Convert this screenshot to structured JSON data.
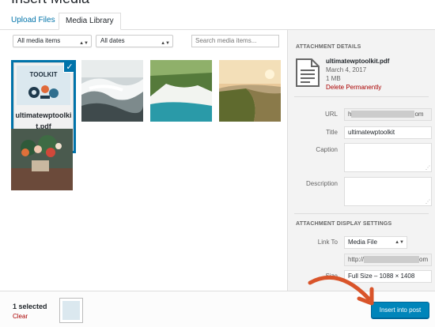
{
  "modal": {
    "title": "Insert Media"
  },
  "tabs": [
    {
      "label": "Upload Files"
    },
    {
      "label": "Media Library"
    }
  ],
  "filters": {
    "type_selected": "All media items",
    "date_selected": "All dates",
    "search_placeholder": "Search media items..."
  },
  "grid": {
    "items": [
      {
        "type": "document",
        "filename": "ultimatewptoolkit.pdf",
        "cover_text": "TOOLKIT",
        "selected": true
      },
      {
        "type": "image",
        "subject": "waves crashing on rocky coast"
      },
      {
        "type": "image",
        "subject": "waterfall in green landscape"
      },
      {
        "type": "image",
        "subject": "coastal cliffs at sunset"
      },
      {
        "type": "image",
        "subject": "flowers on table"
      }
    ]
  },
  "details": {
    "section_title": "Attachment Details",
    "filename": "ultimatewptoolkit.pdf",
    "date": "March 4, 2017",
    "size": "1 MB",
    "delete_label": "Delete Permanently",
    "fields": {
      "url_label": "URL",
      "url_value_start": "h",
      "url_value_end": "om",
      "title_label": "Title",
      "title_value": "ultimatewptoolkit",
      "caption_label": "Caption",
      "description_label": "Description"
    }
  },
  "display_settings": {
    "section_title": "Attachment Display Settings",
    "link_to_label": "Link To",
    "link_to_value": "Media File",
    "link_url_start": "http://",
    "link_url_end": "om",
    "size_label": "Size",
    "size_value": "Full Size – 1088 × 1408"
  },
  "toolbar": {
    "selected_count": "1 selected",
    "clear_label": "Clear",
    "insert_label": "Insert into post"
  },
  "colors": {
    "accent": "#0073aa",
    "button": "#0085ba",
    "delete": "#a00000",
    "annotation": "#d9542a"
  }
}
